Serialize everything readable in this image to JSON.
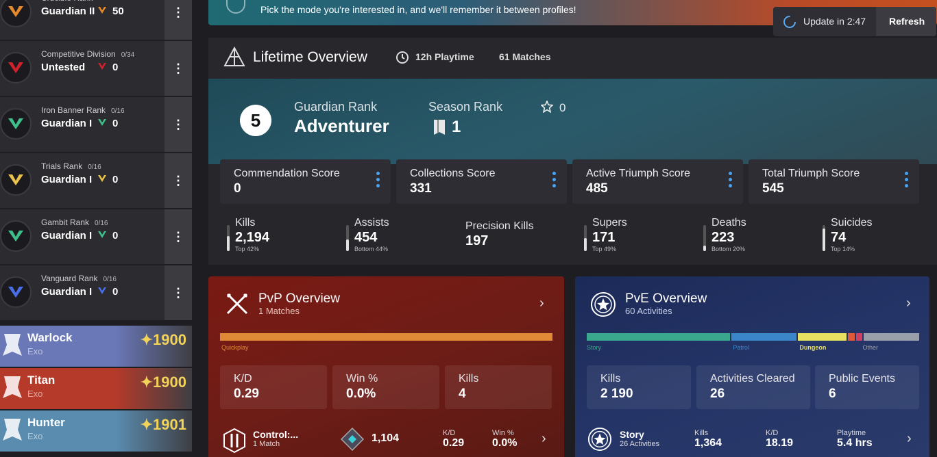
{
  "banner": {
    "text": "Pick the mode you're interested in, and we'll remember it between profiles!"
  },
  "update": {
    "label": "Update in 2:47",
    "refresh_label": "Refresh"
  },
  "ranks": [
    {
      "name": "Crucible Rank",
      "count": "",
      "tier": "Guardian II",
      "value": "50",
      "color": "#e48a2a"
    },
    {
      "name": "Competitive Division",
      "count": "0/34",
      "tier": "Untested",
      "value": "0",
      "color": "#d2202c"
    },
    {
      "name": "Iron Banner Rank",
      "count": "0/16",
      "tier": "Guardian I",
      "value": "0",
      "color": "#3fbf8a"
    },
    {
      "name": "Trials Rank",
      "count": "0/16",
      "tier": "Guardian I",
      "value": "0",
      "color": "#e8c24a"
    },
    {
      "name": "Gambit Rank",
      "count": "0/16",
      "tier": "Guardian I",
      "value": "0",
      "color": "#3fbf8a"
    },
    {
      "name": "Vanguard Rank",
      "count": "0/16",
      "tier": "Guardian I",
      "value": "0",
      "color": "#4a6ee8"
    }
  ],
  "characters": [
    {
      "class": "Warlock",
      "race": "Exo",
      "power": "✦1900",
      "bg": "#6a78b8"
    },
    {
      "class": "Titan",
      "race": "Exo",
      "power": "✦1900",
      "bg": "#b53a2a"
    },
    {
      "class": "Hunter",
      "race": "Exo",
      "power": "✦1901",
      "bg": "#5a8cb0"
    }
  ],
  "lifetime": {
    "title": "Lifetime Overview",
    "playtime": "12h Playtime",
    "matches": "61 Matches",
    "guardian_rank_number": "5",
    "guardian_rank_label": "Guardian Rank",
    "guardian_rank_value": "Adventurer",
    "season_rank_label": "Season Rank",
    "season_rank_value": "1",
    "season_star_value": "0"
  },
  "scores": [
    {
      "label": "Commendation Score",
      "value": "0"
    },
    {
      "label": "Collections Score",
      "value": "331"
    },
    {
      "label": "Active Triumph Score",
      "value": "485"
    },
    {
      "label": "Total Triumph Score",
      "value": "545"
    }
  ],
  "stats": [
    {
      "label": "Kills",
      "value": "2,194",
      "sub": "Top 42%",
      "fill": 0.58
    },
    {
      "label": "Assists",
      "value": "454",
      "sub": "Bottom 44%",
      "fill": 0.44
    },
    {
      "label": "Precision Kills",
      "value": "197",
      "sub": "",
      "fill": null
    },
    {
      "label": "Supers",
      "value": "171",
      "sub": "Top 49%",
      "fill": 0.51
    },
    {
      "label": "Deaths",
      "value": "223",
      "sub": "Bottom 20%",
      "fill": 0.2
    },
    {
      "label": "Suicides",
      "value": "74",
      "sub": "Top 14%",
      "fill": 0.86
    }
  ],
  "pvp": {
    "title": "PvP Overview",
    "subtitle": "1 Matches",
    "bar_label": "Quickplay",
    "bar_color": "#e08a38",
    "kd_label": "K/D",
    "kd_value": "0.29",
    "win_label": "Win %",
    "win_value": "0.0%",
    "kills_label": "Kills",
    "kills_value": "4",
    "mode_name": "Control:...",
    "mode_matches": "1 Match",
    "mode_rating": "1,104",
    "mode_kd_label": "K/D",
    "mode_kd": "0.29",
    "mode_win_label": "Win %",
    "mode_win": "0.0%"
  },
  "pve": {
    "title": "PvE Overview",
    "subtitle": "60 Activities",
    "segments": [
      {
        "label": "Story",
        "value": 0.44,
        "color": "#3aa88c"
      },
      {
        "label": "Patrol",
        "value": 0.2,
        "color": "#3a86c8"
      },
      {
        "label": "Dungeon",
        "value": 0.15,
        "color": "#e8e060"
      },
      {
        "label": "",
        "value": 0.02,
        "color": "#e05a3a"
      },
      {
        "label": "",
        "value": 0.02,
        "color": "#d04060"
      },
      {
        "label": "Other",
        "value": 0.17,
        "color": "#9aa0aa"
      }
    ],
    "kills_label": "Kills",
    "kills_value": "2 190",
    "cleared_label": "Activities Cleared",
    "cleared_value": "26",
    "events_label": "Public Events",
    "events_value": "6",
    "story_name": "Story",
    "story_activities": "26 Activities",
    "story_kills_label": "Kills",
    "story_kills": "1,364",
    "story_kd_label": "K/D",
    "story_kd": "18.19",
    "story_playtime_label": "Playtime",
    "story_playtime": "5.4 hrs"
  }
}
